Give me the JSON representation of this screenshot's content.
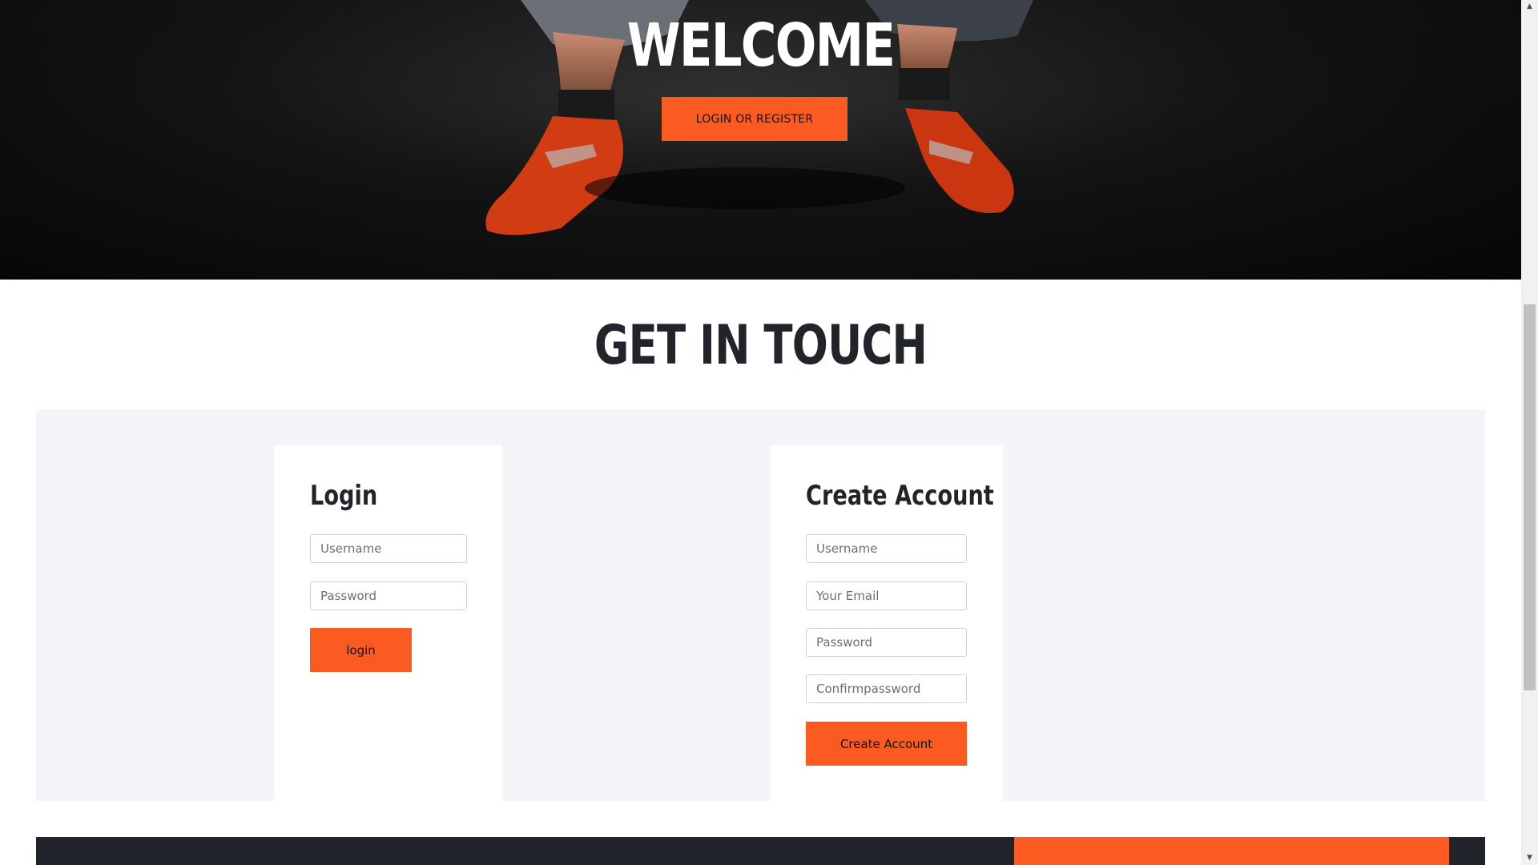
{
  "hero": {
    "title": "WELCOME",
    "cta_label": "LOGIN OR REGISTER"
  },
  "contact": {
    "title": "GET IN TOUCH"
  },
  "login": {
    "title": "Login",
    "username_placeholder": "Username",
    "password_placeholder": "Password",
    "submit_label": "login"
  },
  "create_account": {
    "title": "Create Account",
    "username_placeholder": "Username",
    "email_placeholder": "Your Email",
    "password_placeholder": "Password",
    "confirm_placeholder": "Confirmpassword",
    "submit_label": "Create Account"
  },
  "theme": {
    "accent": "#fb5b21",
    "dark": "#22242b",
    "panel_bg": "#f4f5f8"
  },
  "icons": {
    "scroll_up": "chevron-up-icon",
    "scroll_down": "chevron-down-icon"
  }
}
